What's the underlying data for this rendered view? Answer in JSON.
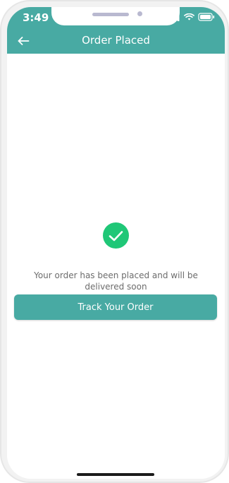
{
  "status_bar": {
    "time": "3:49",
    "icons": [
      "location-arrow-icon",
      "cellular-signal-icon",
      "wifi-icon",
      "battery-icon"
    ]
  },
  "header": {
    "title": "Order Placed",
    "back_icon": "arrow-left-icon"
  },
  "confirmation": {
    "icon": "check-circle-icon",
    "message": "Your order has been placed and will be delivered soon",
    "button_label": "Track Your Order"
  },
  "colors": {
    "primary": "#48aaa3",
    "success": "#1fc777",
    "text_secondary": "#6c6c6c"
  }
}
